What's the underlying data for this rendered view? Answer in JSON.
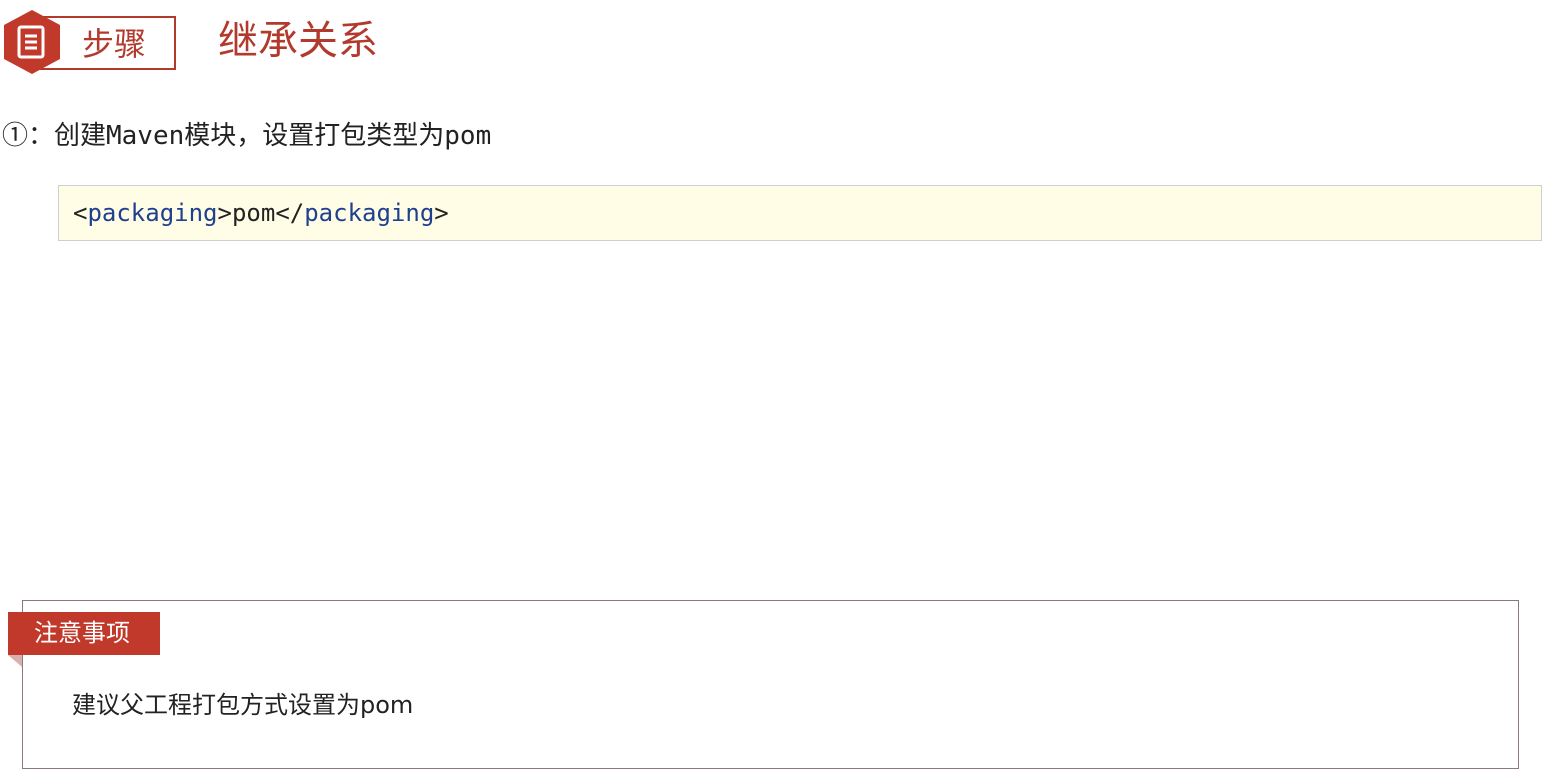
{
  "header": {
    "badge_label": "步骤",
    "badge_icon": "document-icon",
    "title": "继承关系"
  },
  "step": {
    "text": "①：创建Maven模块，设置打包类型为pom"
  },
  "code": {
    "open_bracket": "<",
    "open_tag": "packaging",
    "open_close_bracket": ">",
    "content": "pom",
    "close_open_bracket": "</",
    "close_tag": "packaging",
    "close_close_bracket": ">"
  },
  "notice": {
    "label": "注意事项",
    "text": "建议父工程打包方式设置为pom"
  },
  "colors": {
    "accent": "#b23a2c",
    "notice_tab": "#c0392b",
    "code_background": "#fffde6",
    "code_tag": "#1f3f8f"
  }
}
